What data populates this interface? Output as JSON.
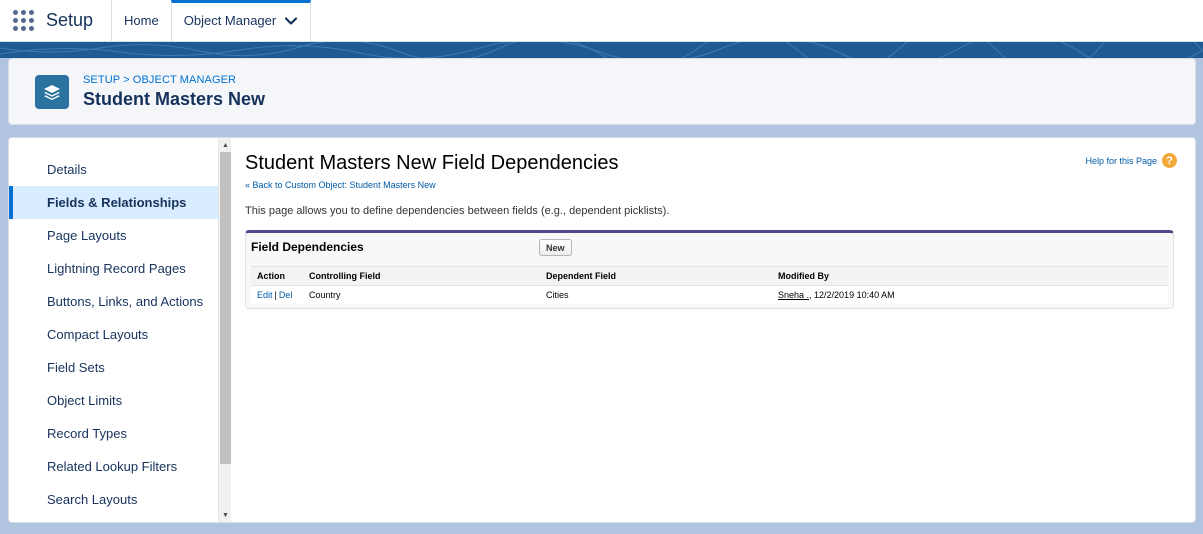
{
  "topnav": {
    "app_name": "Setup",
    "tabs": [
      {
        "label": "Home"
      },
      {
        "label": "Object Manager"
      }
    ]
  },
  "header": {
    "breadcrumb": "SETUP > OBJECT MANAGER",
    "title": "Student Masters New"
  },
  "sidebar": {
    "items": [
      {
        "label": "Details"
      },
      {
        "label": "Fields & Relationships"
      },
      {
        "label": "Page Layouts"
      },
      {
        "label": "Lightning Record Pages"
      },
      {
        "label": "Buttons, Links, and Actions"
      },
      {
        "label": "Compact Layouts"
      },
      {
        "label": "Field Sets"
      },
      {
        "label": "Object Limits"
      },
      {
        "label": "Record Types"
      },
      {
        "label": "Related Lookup Filters"
      },
      {
        "label": "Search Layouts"
      }
    ],
    "active_index": 1
  },
  "content": {
    "title": "Student Masters New Field Dependencies",
    "back_link": "« Back to Custom Object: Student Masters New",
    "help_link": "Help for this Page",
    "description": "This page allows you to define dependencies between fields (e.g., dependent picklists).",
    "block": {
      "title": "Field Dependencies",
      "new_button": "New",
      "columns": [
        "Action",
        "Controlling Field",
        "Dependent Field",
        "Modified By"
      ],
      "rows": [
        {
          "edit": "Edit",
          "separator": "|",
          "del": "Del",
          "controlling": "Country",
          "dependent": "Cities",
          "modified_user": "Sneha .",
          "modified_date": ", 12/2/2019 10:40 AM"
        }
      ]
    }
  },
  "colors": {
    "brand": "#0070d2",
    "banner": "#1f5a93",
    "object_icon": "#2a739e",
    "block_accent": "#56458c",
    "help_icon": "#f3a93a"
  },
  "icons": {
    "app_launcher": "waffle-icon",
    "tab_menu": "chevron-down-icon",
    "object": "layers-icon",
    "help": "help-icon"
  }
}
